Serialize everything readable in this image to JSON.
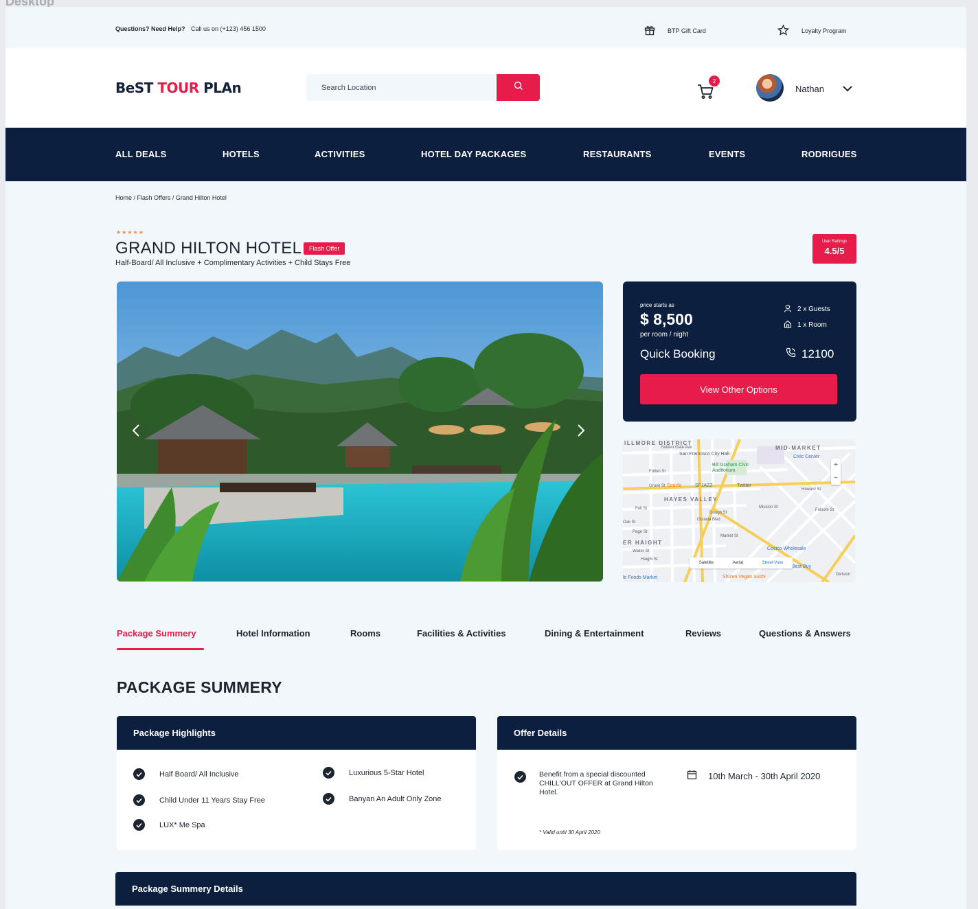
{
  "canvas": {
    "label": "Desktop"
  },
  "topbar": {
    "help_bold": "Questions? Need Help?",
    "help_text": "Call us on (+123) 456 1500",
    "gift_card": "BTP Gift Card",
    "loyalty": "Loyalty Program"
  },
  "header": {
    "logo_part1": "BeST",
    "logo_part2": "TOUR",
    "logo_part3": "PLAn",
    "search_placeholder": "Search Location",
    "cart_count": "2",
    "user_name": "Nathan"
  },
  "nav": {
    "items": [
      "ALL DEALS",
      "HOTELS",
      "ACTIVITIES",
      "HOTEL DAY PACKAGES",
      "RESTAURANTS",
      "EVENTS",
      "RODRIGUES"
    ]
  },
  "breadcrumb": "Home / Flash Offers / Grand Hilton Hotel",
  "hotel": {
    "stars": "★★★★★",
    "star_count": 5,
    "name": "GRAND HILTON HOTEL",
    "badge": "Flash Offer",
    "subtitle": "Half-Board/ All Inclusive + Complimentary Activities + Child Stays Free",
    "rating_label": "User Rattings",
    "rating_value": "4.5/5"
  },
  "booking": {
    "price_label": "price starts as",
    "price": "$ 8,500",
    "price_unit": "per room / night",
    "guests": "2 x Guests",
    "rooms": "1 x Room",
    "quick_booking": "Quick Booking",
    "phone": "12100",
    "button": "View Other Options"
  },
  "map": {
    "districts": [
      "ILLMORE DISTRICT",
      "MID-MARKET",
      "HAYES VALLEY",
      "ER HAIGHT"
    ],
    "places": [
      "San Francisco City Hall",
      "Civic Center",
      "Bill Graham Civic Auditorium",
      "Souvla",
      "SFJAZZ",
      "Twitter",
      "Costco Wholesale",
      "Best Buy",
      "Shizen Vegan Sushi",
      "le Foods Market"
    ],
    "streets": [
      "Golden Gate Ave",
      "Fulton St",
      "Grove St",
      "Fell St",
      "Oak St",
      "Page St",
      "Haight St",
      "Waller St",
      "Market St",
      "Mission St",
      "Howard St",
      "Folsom St",
      "Octavia Blvd",
      "Gough St",
      "Division"
    ],
    "zoom_in": "+",
    "zoom_out": "−",
    "modes": [
      "Satellite",
      "Aerial",
      "Street View"
    ],
    "active_mode": "Street View"
  },
  "tabs": [
    "Package Summery",
    "Hotel Information",
    "Rooms",
    "Facilities & Activities",
    "Dining & Entertainment",
    "Reviews",
    "Questions & Answers"
  ],
  "package": {
    "section_title": "PACKAGE SUMMERY",
    "highlights_title": "Package Highlights",
    "highlights": [
      "Half Board/ All Inclusive",
      "Luxurious 5-Star Hotel",
      "Child Under 11 Years Stay Free",
      "Banyan An Adult Only Zone",
      "LUX* Me Spa"
    ],
    "offer_title": "Offer Details",
    "offer_text": "Benefit from a special discounted CHILL'OUT OFFER at Grand Hilton Hotel.",
    "offer_dates": "10th March - 30th April 2020",
    "offer_valid": "* Valid until 30 April 2020",
    "details_title": "Package Summery Details"
  },
  "colors": {
    "accent": "#e81c4a",
    "navy": "#0c1f3f",
    "background": "#f1f7fb",
    "star": "#f0894a"
  }
}
